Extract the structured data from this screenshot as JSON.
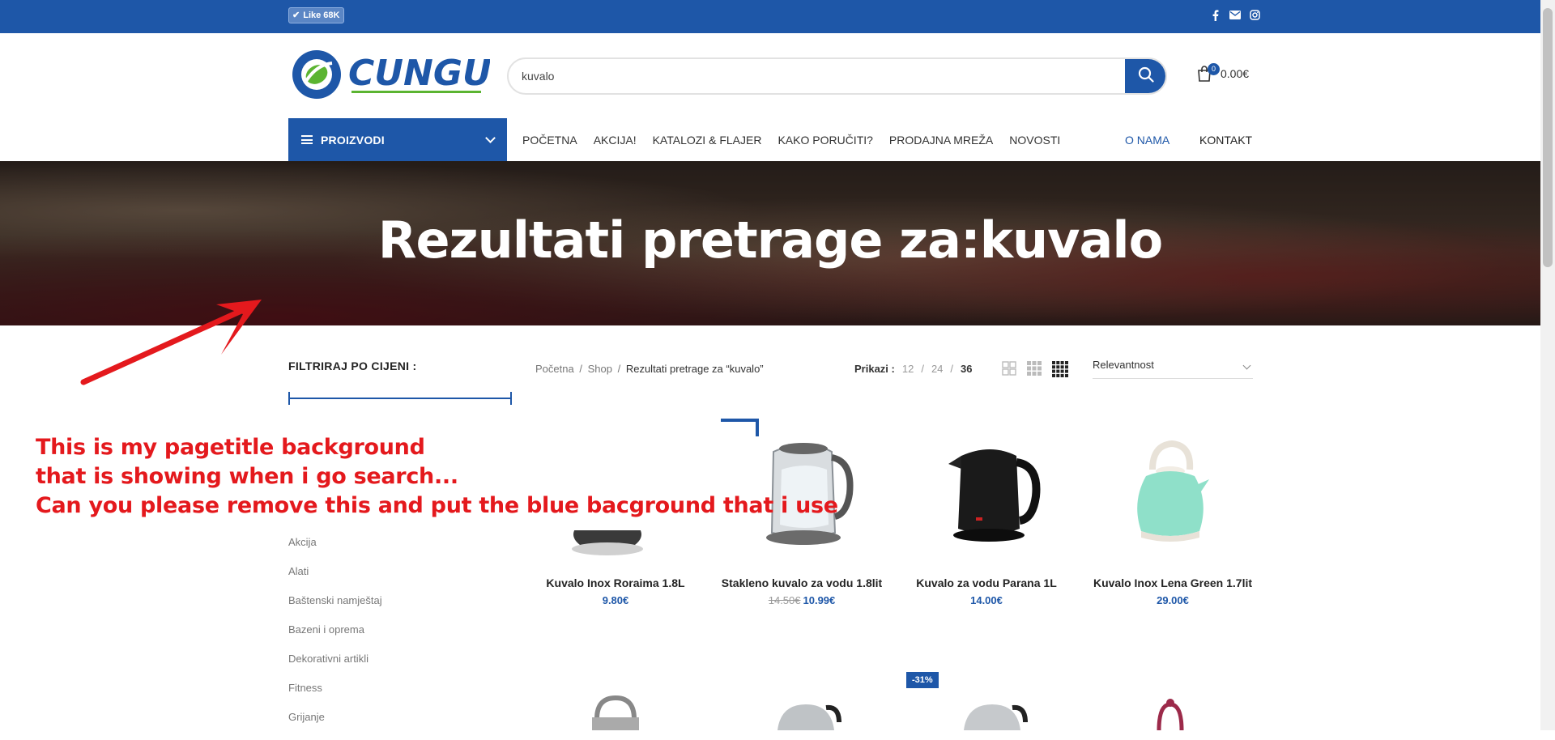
{
  "topbar": {
    "like_label": "Like 68K",
    "icons": [
      "facebook-icon",
      "mail-icon",
      "instagram-icon"
    ]
  },
  "header": {
    "logo_text": "CUNGU",
    "search_value": "kuvalo",
    "cart_count": "0",
    "cart_total": "0.00€"
  },
  "nav": {
    "category_button": "PROIZVODI",
    "items": [
      "POČETNA",
      "AKCIJA!",
      "KATALOZI & FLAJER",
      "KAKO PORUČITI?",
      "PRODAJNA MREŽA",
      "NOVOSTI"
    ],
    "right_items": [
      "O NAMA",
      "KONTAKT"
    ]
  },
  "hero": {
    "title": "Rezultati pretrage za:kuvalo"
  },
  "sidebar": {
    "filter_title": "FILTRIRAJ PO CIJENI :",
    "categories": [
      "Akcija",
      "Alati",
      "Baštenski namještaj",
      "Bazeni i oprema",
      "Dekorativni artikli",
      "Fitness",
      "Grijanje"
    ]
  },
  "toolbar": {
    "breadcrumb": [
      "Početna",
      "Shop",
      "Rezultati pretrage za “kuvalo”"
    ],
    "prikazi_label": "Prikazi :",
    "per_page": [
      "12",
      "24",
      "36"
    ],
    "per_page_separator": "/",
    "sort_value": "Relevantnost"
  },
  "products": [
    {
      "name": "Kuvalo Inox Roraima 1.8L",
      "old_price": "",
      "price": "9.80€"
    },
    {
      "name": "Stakleno kuvalo za vodu 1.8lit",
      "old_price": "14.50€",
      "price": "10.99€"
    },
    {
      "name": "Kuvalo za vodu Parana 1L",
      "old_price": "",
      "price": "14.00€"
    },
    {
      "name": "Kuvalo Inox Lena Green 1.7lit",
      "old_price": "",
      "price": "29.00€"
    }
  ],
  "sale_badge": "-31%",
  "annotation": {
    "line1": "This is my pagetitle background",
    "line2": "that is showing when i go search...",
    "line3": "Can you please remove this and put the blue bacground that i use"
  },
  "colors": {
    "brand_blue": "#1e57a8",
    "annotation_red": "#e4191d",
    "logo_green": "#5bb431"
  }
}
